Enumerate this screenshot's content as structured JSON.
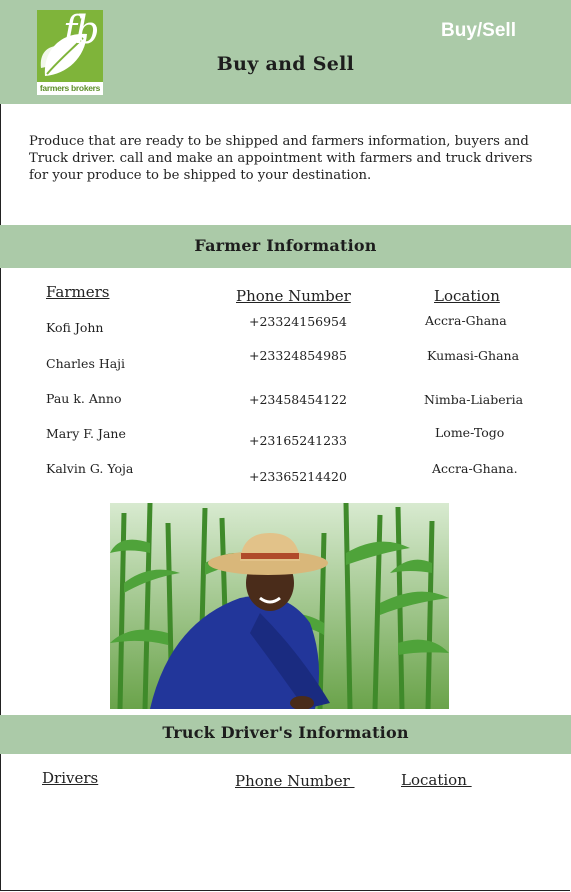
{
  "header": {
    "logo_text": "farmers brokers",
    "logo_letters": "fb",
    "nav_link": "Buy/Sell",
    "title": "Buy and Sell"
  },
  "intro": "Produce that are ready to be shipped and farmers information, buyers and Truck driver. call and make an appointment with farmers and truck drivers for your produce to be shipped to your destination.",
  "farmer_section": {
    "title": "Farmer Information",
    "columns": [
      "Farmers",
      "Phone Number",
      "Location"
    ],
    "rows": [
      {
        "name": "Kofi John",
        "phone": "+23324156954",
        "location": "Accra-Ghana"
      },
      {
        "name": "Charles Haji",
        "phone": "+23324854985",
        "location": "Kumasi-Ghana"
      },
      {
        "name": "Pau k. Anno",
        "phone": "+23458454122",
        "location": "Nimba-Liaberia"
      },
      {
        "name": "Mary F. Jane",
        "phone": "+23165241233",
        "location": "Lome-Togo"
      },
      {
        "name": "Kalvin G. Yoja",
        "phone": "+23365214420",
        "location": "Accra-Ghana."
      }
    ]
  },
  "truck_section": {
    "title": "Truck Driver's Information",
    "columns": [
      "Drivers",
      "Phone Number ",
      "Location "
    ]
  },
  "colors": {
    "band": "#abcaa8",
    "logo_green": "#7fb43a"
  }
}
